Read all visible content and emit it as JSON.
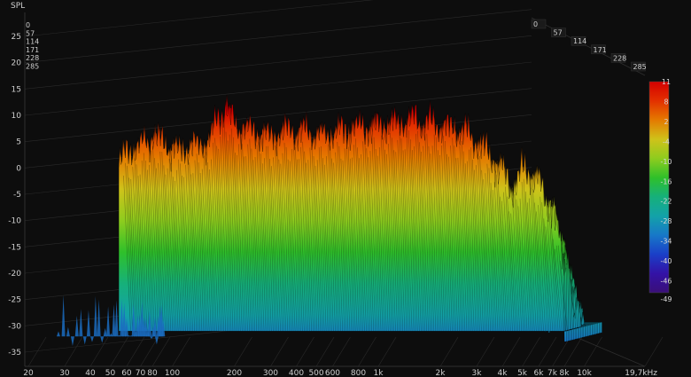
{
  "chart_data": {
    "type": "area",
    "ylabel": "SPL",
    "xunit": "kHz",
    "y_ticks": [
      25,
      20,
      15,
      10,
      5,
      0,
      -5,
      -10,
      -15,
      -20,
      -25,
      -30,
      -35
    ],
    "ylim": [
      -37,
      30
    ],
    "x_ticks": [
      {
        "f": 20,
        "label": "20"
      },
      {
        "f": 30,
        "label": "30"
      },
      {
        "f": 40,
        "label": "40"
      },
      {
        "f": 50,
        "label": "50"
      },
      {
        "f": 60,
        "label": "60"
      },
      {
        "f": 70,
        "label": "70"
      },
      {
        "f": 80,
        "label": "80"
      },
      {
        "f": 100,
        "label": "100"
      },
      {
        "f": 200,
        "label": "200"
      },
      {
        "f": 300,
        "label": "300"
      },
      {
        "f": 400,
        "label": "400"
      },
      {
        "f": 500,
        "label": "500"
      },
      {
        "f": 600,
        "label": "600"
      },
      {
        "f": 800,
        "label": "800"
      },
      {
        "f": 1000,
        "label": "1k"
      },
      {
        "f": 2000,
        "label": "2k"
      },
      {
        "f": 3000,
        "label": "3k"
      },
      {
        "f": 4000,
        "label": "4k"
      },
      {
        "f": 5000,
        "label": "5k"
      },
      {
        "f": 6000,
        "label": "6k"
      },
      {
        "f": 7000,
        "label": "7k"
      },
      {
        "f": 8000,
        "label": "8k"
      },
      {
        "f": 10000,
        "label": "10k"
      },
      {
        "f": 19700,
        "label": "19,7kHz"
      }
    ],
    "xlim": [
      20,
      19700
    ],
    "time_slices": [
      "0",
      "57",
      "114",
      "171",
      "228",
      "285"
    ],
    "colorbar": {
      "levels": [
        "11",
        "8",
        "2",
        "-4",
        "-10",
        "-16",
        "-22",
        "-28",
        "-34",
        "-40",
        "-46",
        "-49"
      ],
      "range": [
        -49,
        11
      ]
    },
    "front_slice_envelope": {
      "freq": [
        55,
        60,
        70,
        80,
        90,
        100,
        120,
        150,
        180,
        200,
        250,
        300,
        400,
        500,
        700,
        1000,
        1500,
        2000,
        2500,
        3000,
        3500,
        4000,
        4500,
        5000,
        6000,
        7000,
        8000
      ],
      "spl": [
        1,
        3,
        4,
        6,
        5,
        3,
        4,
        5,
        12,
        8,
        7,
        6,
        7,
        6,
        7,
        8,
        9,
        8,
        7,
        5,
        2,
        -1,
        -4,
        0,
        -3,
        -8,
        -18
      ]
    }
  }
}
